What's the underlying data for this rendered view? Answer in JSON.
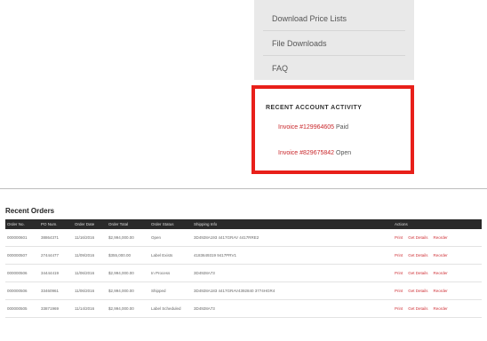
{
  "nav": {
    "links": [
      "Download Price Lists",
      "File Downloads",
      "FAQ"
    ]
  },
  "activity": {
    "title": "RECENT ACCOUNT ACTIVITY",
    "items": [
      {
        "number": "Invoice #129964605",
        "status": "Paid"
      },
      {
        "number": "Invoice #829675842",
        "status": "Open"
      }
    ]
  },
  "orders": {
    "title": "Recent Orders",
    "columns": [
      "Order No.",
      "PO Num.",
      "Order Date",
      "Order Total",
      "Order Status",
      "Shipping Info",
      "Actions"
    ],
    "rows": [
      {
        "order_no": "000000601",
        "po": "38864371",
        "date": "11/16/2016",
        "total": "$2,994,000.00",
        "status": "Open",
        "info": "3D4928A193 4417GRAV 4417RRE2"
      },
      {
        "order_no": "000000507",
        "po": "27444477",
        "date": "11/09/2016",
        "total": "$355,000.00",
        "status": "Label Exists",
        "info": "4183649319 9417PRV1"
      },
      {
        "order_no": "000000506",
        "po": "34444419",
        "date": "11/06/2016",
        "total": "$2,994,000.00",
        "status": "In Process",
        "info": "3D4928A73"
      },
      {
        "order_no": "000000506",
        "po": "33460961",
        "date": "11/06/2016",
        "total": "$2,994,000.00",
        "status": "Shipped",
        "info": "3D4928A183 4417GRAV4392840 3774HGR4"
      },
      {
        "order_no": "000000505",
        "po": "33871969",
        "date": "11/14/2016",
        "total": "$2,994,000.00",
        "status": "Label Scheduled",
        "info": "3D4928A73"
      }
    ],
    "actions": [
      "Print",
      "Get Details",
      "Reorder"
    ]
  },
  "colors": {
    "accent_red": "#e8201a",
    "link_red": "#c9272b",
    "table_header": "#2a2a2a",
    "nav_panel": "#e9e9e9"
  }
}
